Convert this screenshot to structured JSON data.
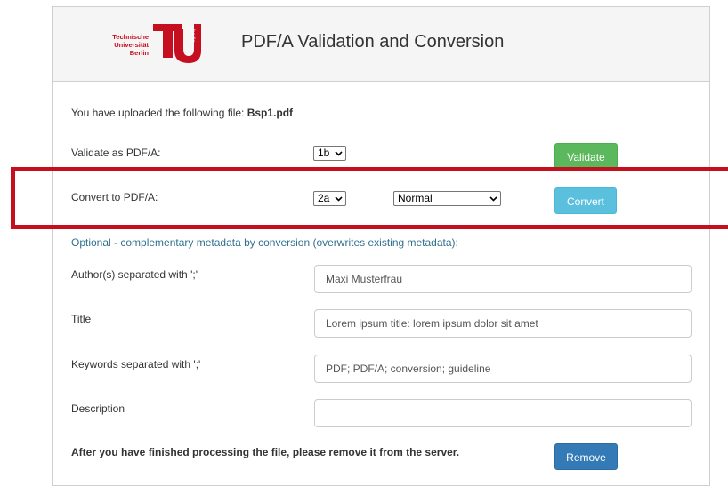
{
  "header": {
    "logo_text": [
      "Technische",
      "Universität",
      "Berlin"
    ],
    "logo_vertical_text": "berlin",
    "title": "PDF/A Validation and Conversion"
  },
  "upload": {
    "prefix": "You have uploaded the following file: ",
    "filename": "Bsp1.pdf"
  },
  "validate": {
    "label": "Validate as PDF/A:",
    "level": "1b",
    "button": "Validate"
  },
  "convert": {
    "label": "Convert to PDF/A:",
    "level": "2a",
    "mode": "Normal",
    "button": "Convert"
  },
  "optional_note": "Optional - complementary metadata by conversion (overwrites existing metadata):",
  "fields": [
    {
      "label": "Author(s) separated with ';'",
      "value": "Maxi Musterfrau"
    },
    {
      "label": "Title",
      "value": "Lorem ipsum title: lorem ipsum dolor sit amet"
    },
    {
      "label": "Keywords separated with ';'",
      "value": "PDF; PDF/A; conversion; guideline"
    },
    {
      "label": "Description",
      "value": ""
    }
  ],
  "remove": {
    "notice": "After you have finished processing the file, please remove it from the server.",
    "button": "Remove"
  },
  "colors": {
    "tu_red": "#c50e1f",
    "highlight": "#c4101e",
    "validate_btn": "#5cb85c",
    "convert_btn": "#5bc0de",
    "remove_btn": "#337ab7",
    "info_text": "#31708f"
  }
}
